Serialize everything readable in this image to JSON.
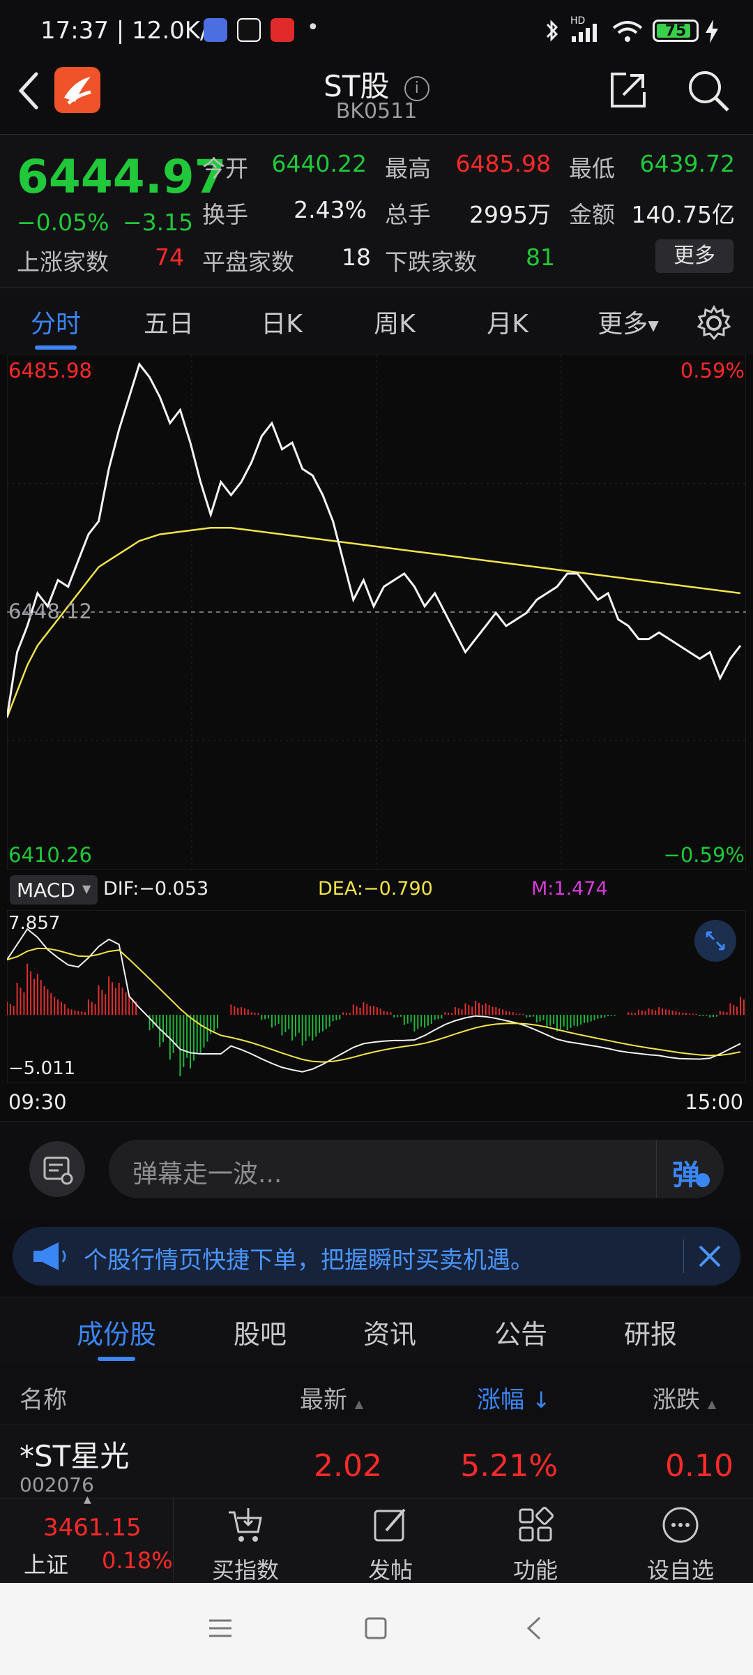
{
  "status_bar": {
    "time_speed": "17:37 | 12.0K/s",
    "dot": "•",
    "battery": "75",
    "hd": "HD"
  },
  "header": {
    "name": "ST股",
    "code": "BK0511"
  },
  "quote": {
    "price": "6444.97",
    "change_pct": "−0.05%",
    "change": "−3.15",
    "open_label": "今开",
    "open": "6440.22",
    "high_label": "最高",
    "high": "6485.98",
    "low_label": "最低",
    "low": "6439.72",
    "turnover_label": "换手",
    "turnover": "2.43%",
    "volume_label": "总手",
    "volume": "2995万",
    "amount_label": "金额",
    "amount": "140.75亿",
    "up_label": "上涨家数",
    "up": "74",
    "flat_label": "平盘家数",
    "flat": "18",
    "down_label": "下跌家数",
    "down": "81",
    "more": "更多"
  },
  "tabs": [
    "分时",
    "五日",
    "日K",
    "周K",
    "月K",
    "更多"
  ],
  "colors": {
    "accent": "#3b86f5",
    "up": "#ff2a2a",
    "down": "#20c83a",
    "avg": "#f2e34a"
  },
  "chart_data": [
    {
      "type": "line",
      "x_start": "09:30",
      "x_end": "15:00",
      "ylim": [
        6410.26,
        6485.98
      ],
      "y_top_label": "6485.98",
      "y_bottom_label": "6410.26",
      "pct_top": "0.59%",
      "pct_bottom": "−0.59%",
      "ref_label": "6448.12",
      "ref": 6448.12,
      "series": [
        {
          "values": [
            6432,
            6442,
            6446,
            6451,
            6449,
            6453,
            6452,
            6456,
            6460,
            6462,
            6470,
            6476,
            6481,
            6486,
            6484,
            6481,
            6477,
            6479,
            6474,
            6468,
            6463,
            6468,
            6466,
            6468,
            6471,
            6475,
            6477,
            6473,
            6474,
            6470,
            6469,
            6466,
            6462,
            6456,
            6450,
            6453,
            6449,
            6452,
            6453,
            6454,
            6452,
            6449,
            6451,
            6448,
            6445,
            6442,
            6444,
            6446,
            6448,
            6446,
            6447,
            6448,
            6450,
            6451,
            6452,
            6454,
            6454,
            6452,
            6450,
            6451,
            6447,
            6446,
            6444,
            6444,
            6445,
            6444,
            6443,
            6442,
            6441,
            6442,
            6438,
            6441,
            6443
          ]
        },
        {
          "values": [
            6432,
            6436,
            6440,
            6443,
            6445,
            6447,
            6449,
            6451,
            6453,
            6455,
            6456,
            6457,
            6458,
            6459,
            6459.5,
            6460,
            6460.2,
            6460.4,
            6460.6,
            6460.8,
            6461,
            6461,
            6461,
            6460.8,
            6460.6,
            6460.4,
            6460.2,
            6460,
            6459.8,
            6459.6,
            6459.4,
            6459.2,
            6459,
            6458.8,
            6458.6,
            6458.4,
            6458.2,
            6458,
            6457.8,
            6457.6,
            6457.4,
            6457.2,
            6457,
            6456.8,
            6456.6,
            6456.4,
            6456.2,
            6456,
            6455.8,
            6455.6,
            6455.4,
            6455.2,
            6455,
            6454.8,
            6454.6,
            6454.4,
            6454.2,
            6454,
            6453.8,
            6453.6,
            6453.4,
            6453.2,
            6453,
            6452.8,
            6452.6,
            6452.4,
            6452.2,
            6452,
            6451.8,
            6451.6,
            6451.4,
            6451.2,
            6451
          ]
        }
      ]
    },
    {
      "type": "bar",
      "indicator": "MACD",
      "dif": "DIF:−0.053",
      "dea": "DEA:−0.790",
      "m": "M:1.474",
      "ylim": [
        -5.011,
        7.857
      ],
      "y_top_label": "7.857",
      "y_bottom_label": "−5.011",
      "values": [
        1.0,
        2.5,
        4.0,
        3.2,
        2.0,
        1.2,
        0.5,
        0.3,
        1.2,
        2.3,
        3.0,
        2.5,
        1.5,
        0.0,
        -1.2,
        -2.5,
        -3.5,
        -4.8,
        -4.2,
        -3.0,
        -1.5,
        0.0,
        0.8,
        0.6,
        0.2,
        -0.4,
        -1.0,
        -1.6,
        -2.0,
        -2.4,
        -2.0,
        -1.3,
        -0.5,
        0.2,
        0.8,
        1.0,
        0.7,
        0.3,
        -0.2,
        -0.8,
        -1.3,
        -1.0,
        -0.4,
        0.2,
        0.6,
        0.9,
        1.1,
        0.9,
        0.6,
        0.3,
        0.1,
        -0.2,
        -0.6,
        -1.0,
        -1.3,
        -1.2,
        -0.9,
        -0.6,
        -0.3,
        -0.1,
        0.0,
        0.2,
        0.4,
        0.5,
        0.6,
        0.4,
        0.2,
        0.1,
        -0.1,
        -0.2,
        0.3,
        0.9,
        1.4
      ]
    }
  ],
  "comment_bar": {
    "placeholder": "弹幕走一波...",
    "danmu_button": "弹"
  },
  "promo": {
    "text": "个股行情页快捷下单，把握瞬时买卖机遇。"
  },
  "subtabs": [
    "成份股",
    "股吧",
    "资讯",
    "公告",
    "研报"
  ],
  "table": {
    "headers": {
      "name": "名称",
      "latest": "最新",
      "change_pct": "涨幅",
      "change": "涨跌"
    },
    "rows": [
      {
        "name": "*ST星光",
        "code": "002076",
        "latest": "2.02",
        "change_pct": "5.21%",
        "change": "0.10"
      }
    ]
  },
  "bottom_nav": {
    "index_value": "3461.15",
    "index_name": "上证",
    "index_pct": "0.18%",
    "items": [
      "买指数",
      "发帖",
      "功能",
      "设自选"
    ]
  }
}
